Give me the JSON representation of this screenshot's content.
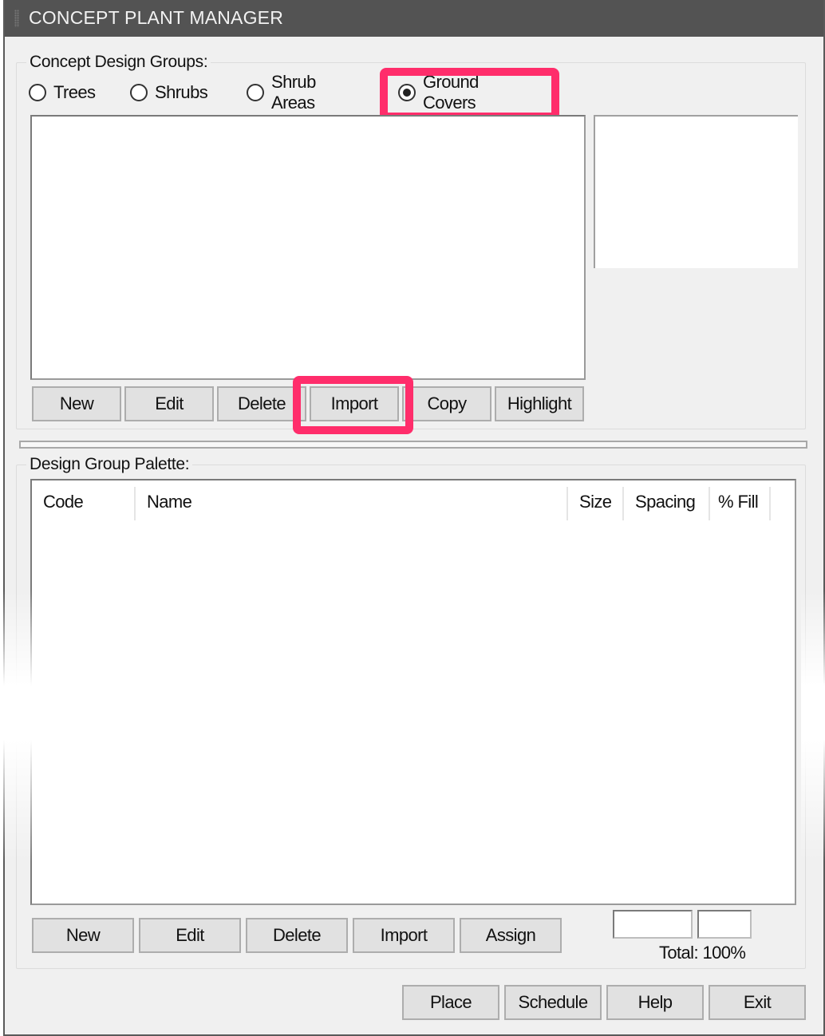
{
  "window": {
    "title": "CONCEPT PLANT MANAGER"
  },
  "concept_groups": {
    "legend": "Concept Design Groups:",
    "radios": [
      {
        "label": "Trees",
        "checked": false
      },
      {
        "label": "Shrubs",
        "checked": false
      },
      {
        "label": "Shrub Areas",
        "checked": false
      },
      {
        "label": "Ground Covers",
        "checked": true
      }
    ],
    "list_items": [],
    "buttons": {
      "new": "New",
      "edit": "Edit",
      "delete": "Delete",
      "import": "Import",
      "copy": "Copy",
      "highlight": "Highlight"
    }
  },
  "palette": {
    "legend": "Design Group Palette:",
    "columns": [
      "Code",
      "Name",
      "Size",
      "Spacing",
      "% Fill"
    ],
    "rows": [],
    "buttons": {
      "new": "New",
      "edit": "Edit",
      "delete": "Delete",
      "import": "Import",
      "assign": "Assign"
    },
    "field_1_value": "",
    "field_2_value": "",
    "total_label": "Total: 100%"
  },
  "footer": {
    "place": "Place",
    "schedule": "Schedule",
    "help": "Help",
    "exit": "Exit"
  },
  "annotations": {
    "highlight_color": "#ff2d6b",
    "highlighted": [
      "Ground Covers",
      "Import"
    ]
  }
}
